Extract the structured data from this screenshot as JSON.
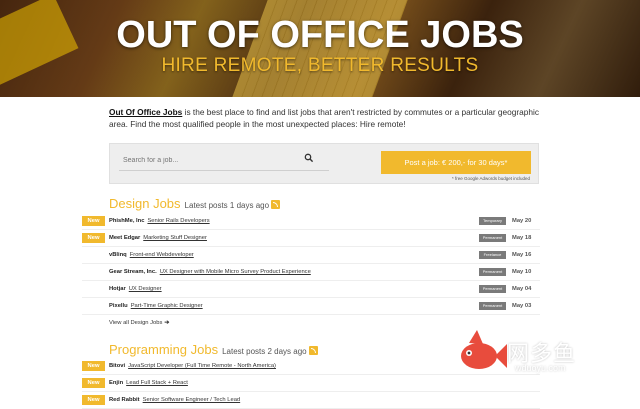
{
  "header": {
    "title": "OUT OF OFFICE JOBS",
    "subtitle": "HIRE REMOTE, BETTER RESULTS"
  },
  "intro": {
    "brand": "Out Of Office Jobs",
    "text": " is the best place to find and list jobs that aren't restricted by commutes or a particular geographic area. Find the most qualified people in the most unexpected places: Hire remote!"
  },
  "search": {
    "placeholder": "Search for a job...",
    "icon": "search-icon"
  },
  "post_job": {
    "label": "Post a job: € 200,- for 30 days*",
    "note": "* free Google Adwords budget included"
  },
  "design": {
    "title": "Design Jobs",
    "latest": "Latest posts 1 days ago",
    "view_all": "View all Design Jobs",
    "jobs": [
      {
        "new": "New",
        "company": "PhishMe, Inc",
        "role": "Senior Rails Developers",
        "type": "Temporary",
        "date": "May 20"
      },
      {
        "new": "New",
        "company": "Meet Edgar",
        "role": "Marketing Stuff Designer",
        "type": "Permanent",
        "date": "May 18"
      },
      {
        "new": "",
        "company": "vBlinq",
        "role": "Front-end Webdeveloper",
        "type": "Freelance",
        "date": "May 16"
      },
      {
        "new": "",
        "company": "Gear Stream, Inc.",
        "role": "UX Designer with Mobile Micro Survey Product Experience",
        "type": "Permanent",
        "date": "May 10"
      },
      {
        "new": "",
        "company": "Hotjar",
        "role": "UX Designer",
        "type": "Permanent",
        "date": "May 04"
      },
      {
        "new": "",
        "company": "Pixellu",
        "role": "Part-Time Graphic Designer",
        "type": "Permanent",
        "date": "May 03"
      }
    ]
  },
  "programming": {
    "title": "Programming Jobs",
    "latest": "Latest posts 2 days ago",
    "jobs": [
      {
        "new": "New",
        "company": "Bitovi",
        "role": "JavaScript Developer (Full Time Remote - North America)",
        "type": "",
        "date": ""
      },
      {
        "new": "New",
        "company": "Enjin",
        "role": "Lead Full Stack + React",
        "type": "",
        "date": ""
      },
      {
        "new": "New",
        "company": "Red Rabbit",
        "role": "Senior Software Engineer / Tech Lead",
        "type": "",
        "date": ""
      }
    ]
  },
  "watermark": {
    "text": "网多鱼",
    "url": "wduoyu.com"
  },
  "colors": {
    "accent": "#f1b92d",
    "badge_gray": "#7a7a7a",
    "watermark_fish": "#e84c3d"
  }
}
